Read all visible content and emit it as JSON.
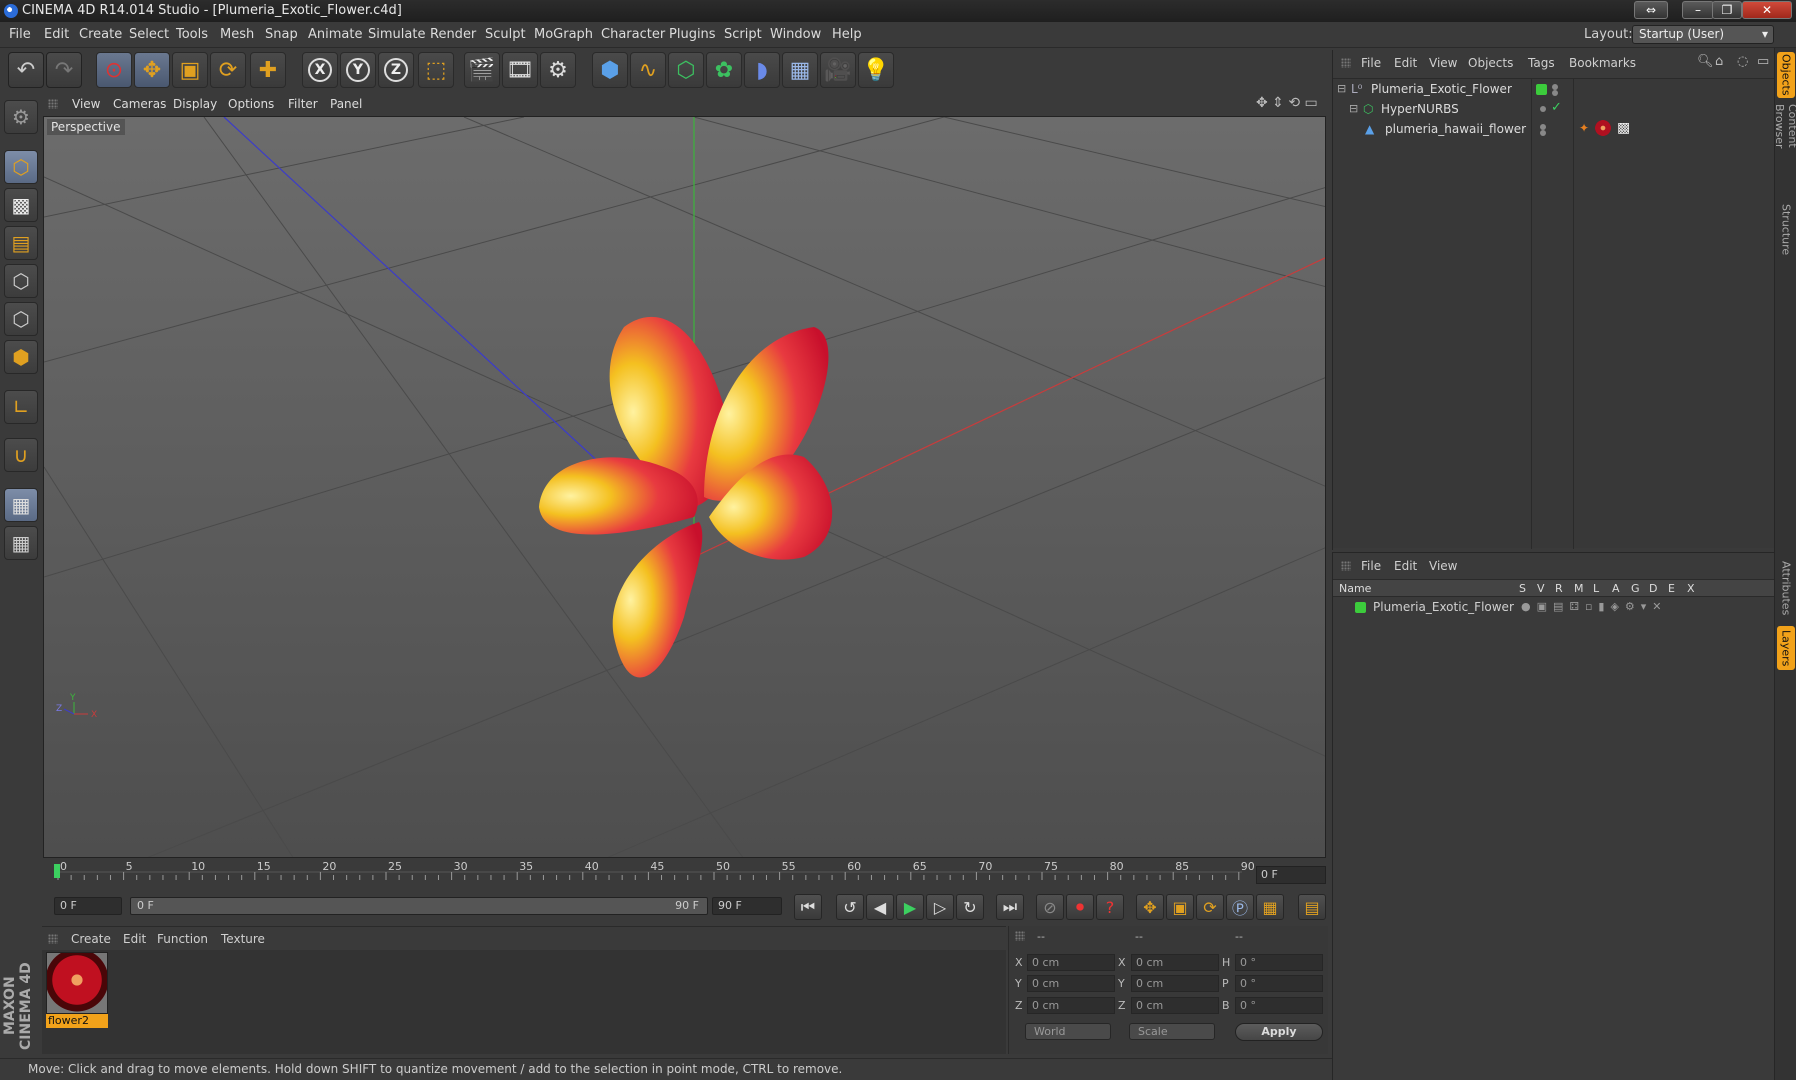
{
  "window": {
    "title": "CINEMA 4D R14.014 Studio - [Plumeria_Exotic_Flower.c4d]",
    "buttons": [
      "⇔",
      "–",
      "❐",
      "✕"
    ]
  },
  "menubar": {
    "items": [
      "File",
      "Edit",
      "Create",
      "Select",
      "Tools",
      "Mesh",
      "Snap",
      "Animate",
      "Simulate",
      "Render",
      "Sculpt",
      "MoGraph",
      "Character",
      "Plugins",
      "Script",
      "Window",
      "Help"
    ],
    "layout_label": "Layout:",
    "layout_value": "Startup (User)"
  },
  "toolbar": {
    "undo": "↶",
    "redo": "↷",
    "axis_x": "X",
    "axis_y": "Y",
    "axis_z": "Z"
  },
  "viewport": {
    "menu": [
      "View",
      "Cameras",
      "Display",
      "Options",
      "Filter",
      "Panel"
    ],
    "label": "Perspective",
    "axis_colors": {
      "x": "#c83c3c",
      "y": "#3cb43c",
      "z": "#3c3cc8"
    },
    "gizmo": {
      "x": "X",
      "y": "Y",
      "z": "Z"
    }
  },
  "timeline": {
    "ticks": [
      "0",
      "5",
      "10",
      "15",
      "20",
      "25",
      "30",
      "35",
      "40",
      "45",
      "50",
      "55",
      "60",
      "65",
      "70",
      "75",
      "80",
      "85",
      "90"
    ],
    "end_field": "0 F",
    "current_frame": "0 F",
    "range_start": "0 F",
    "range_end": "90 F",
    "max_frame": "90 F"
  },
  "materials": {
    "menu": [
      "Create",
      "Edit",
      "Function",
      "Texture"
    ],
    "items": [
      {
        "name": "flower2"
      }
    ]
  },
  "coordinates": {
    "headers": [
      "--",
      "--",
      "--"
    ],
    "rows": [
      {
        "a": "X",
        "av": "0 cm",
        "b": "X",
        "bv": "0 cm",
        "c": "H",
        "cv": "0 °"
      },
      {
        "a": "Y",
        "av": "0 cm",
        "b": "Y",
        "bv": "0 cm",
        "c": "P",
        "cv": "0 °"
      },
      {
        "a": "Z",
        "av": "0 cm",
        "b": "Z",
        "bv": "0 cm",
        "c": "B",
        "cv": "0 °"
      }
    ],
    "mode_world": "World",
    "mode_scale": "Scale",
    "apply": "Apply"
  },
  "status": "Move: Click and drag to move elements. Hold down SHIFT to quantize movement / add to the selection in point mode, CTRL to remove.",
  "objects": {
    "menu": [
      "File",
      "Edit",
      "View",
      "Objects",
      "Tags",
      "Bookmarks"
    ],
    "tree": [
      "Plumeria_Exotic_Flower",
      "HyperNURBS",
      "plumeria_hawaii_flower"
    ]
  },
  "layers": {
    "menu": [
      "File",
      "Edit",
      "View"
    ],
    "columns": [
      "Name",
      "S",
      "V",
      "R",
      "M",
      "L",
      "A",
      "G",
      "D",
      "E",
      "X"
    ],
    "rows": [
      {
        "name": "Plumeria_Exotic_Flower",
        "color": "#3ccc3c"
      }
    ]
  },
  "right_tabs": [
    "Objects",
    "Content Browser",
    "Structure",
    "Attributes",
    "Layers"
  ]
}
